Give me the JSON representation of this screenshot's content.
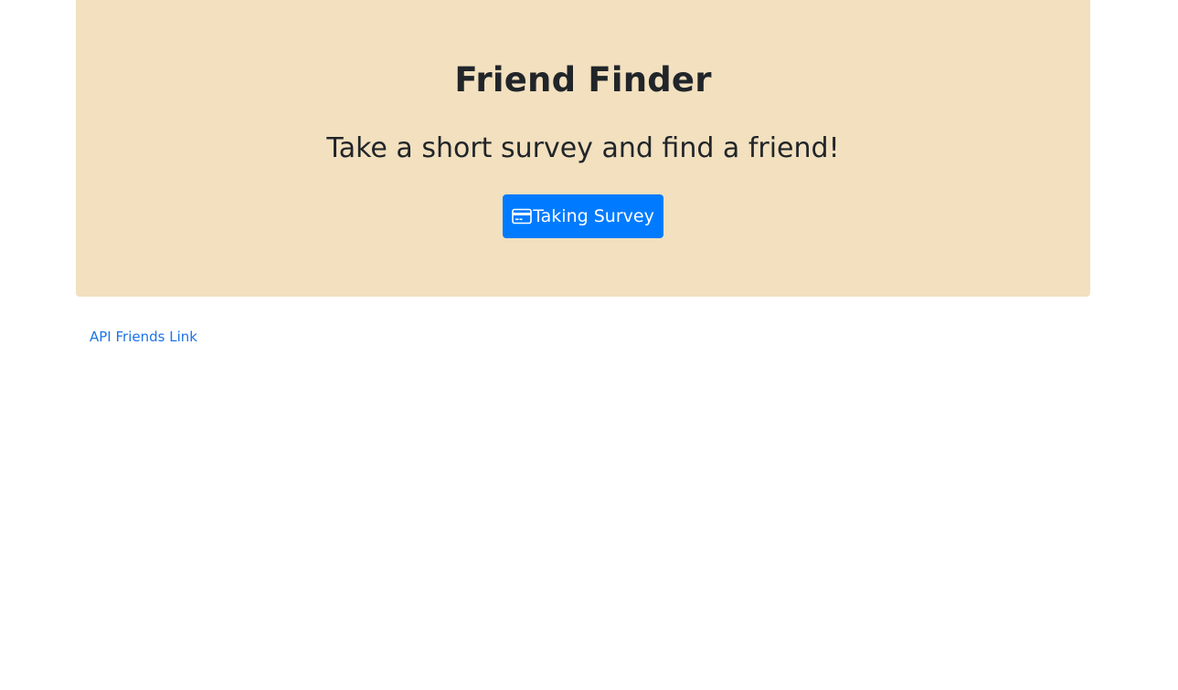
{
  "header": {
    "title": "Friend Finder",
    "subtitle": "Take a short survey and find a friend!",
    "background_color": "#f2e0bf"
  },
  "survey_button": {
    "label": "Taking Survey",
    "icon": "credit-card-icon",
    "color": "#007bff"
  },
  "links": {
    "api_friends": "API Friends Link",
    "color": "#1a73e8"
  }
}
